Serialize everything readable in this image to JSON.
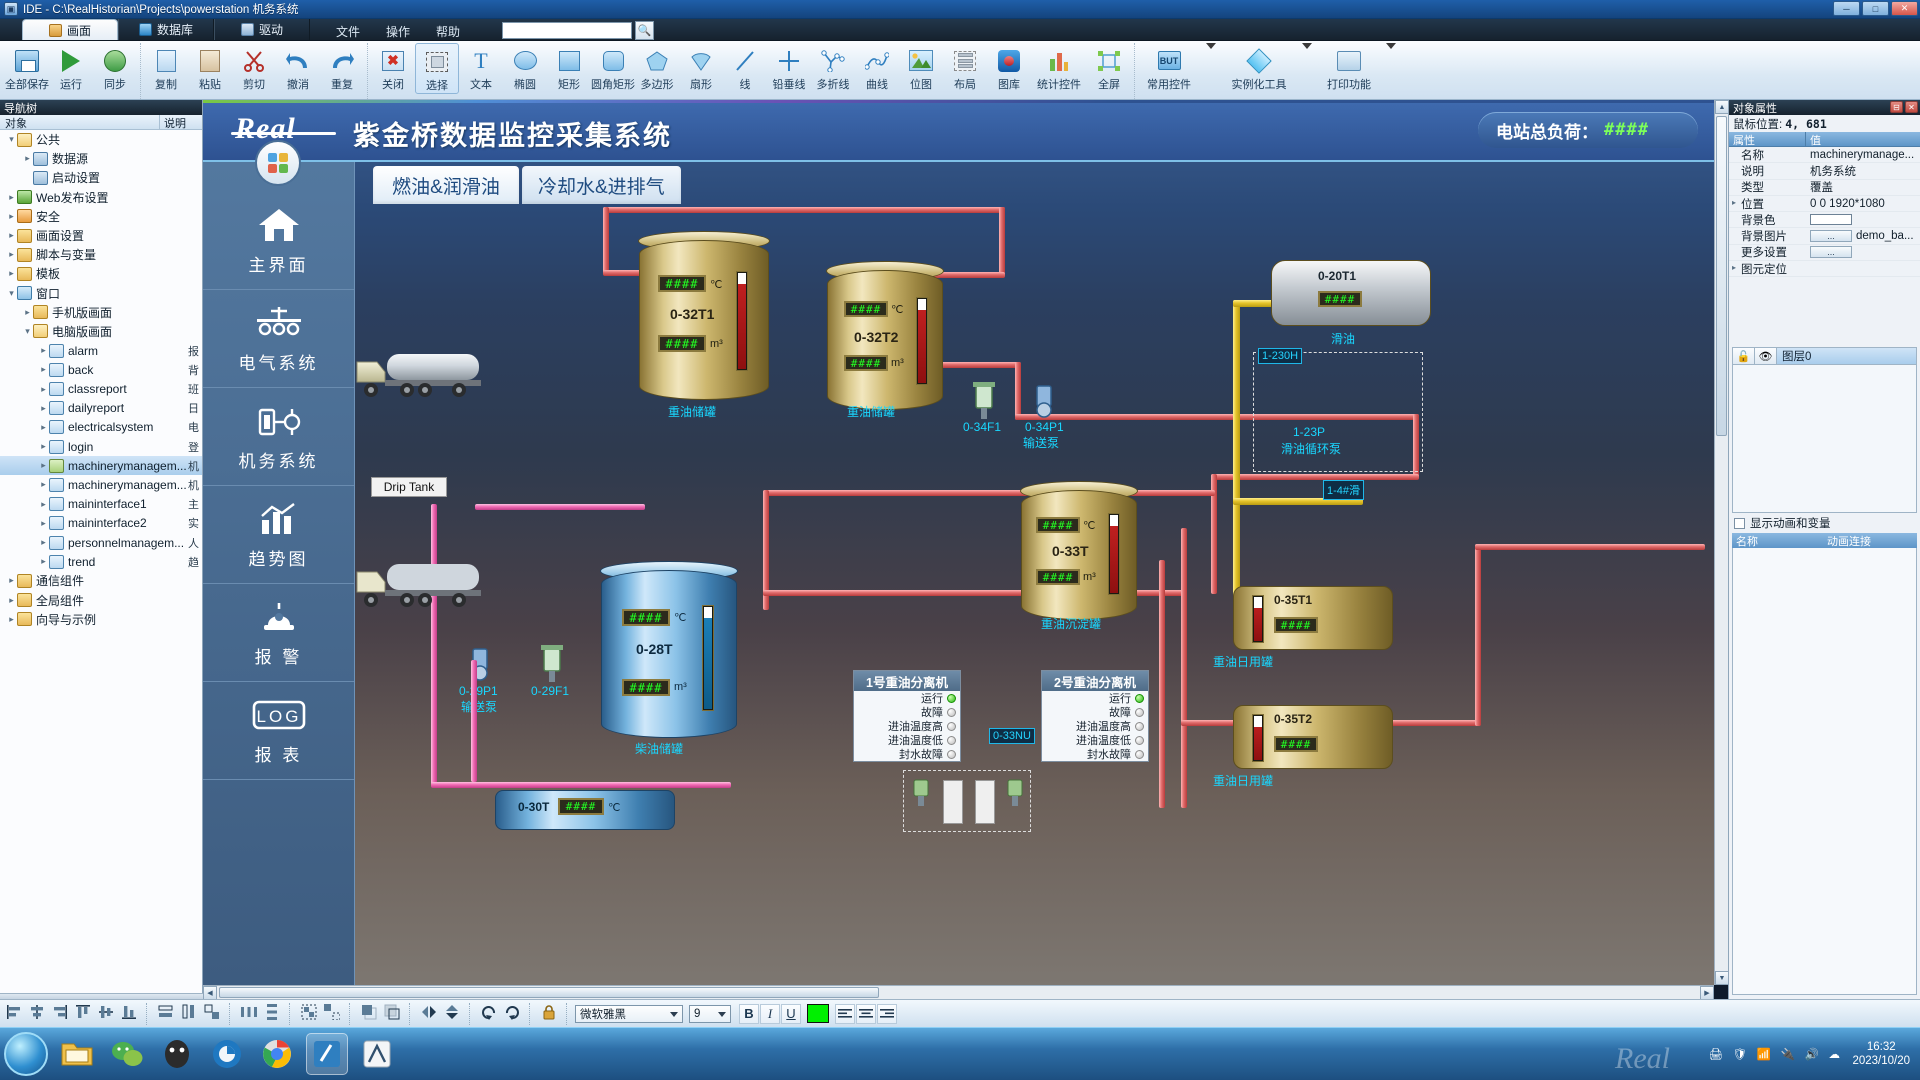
{
  "window": {
    "title": "IDE - C:\\RealHistorian\\Projects\\powerstation  机务系统",
    "minimize": "─",
    "maximize": "□",
    "close": "✕"
  },
  "ribbon_tabs": [
    {
      "label": "画面",
      "icon": "picture-icon",
      "active": true
    },
    {
      "label": "数据库",
      "icon": "database-icon",
      "active": false
    },
    {
      "label": "驱动",
      "icon": "driver-icon",
      "active": false
    }
  ],
  "menu": [
    "文件",
    "操作",
    "帮助"
  ],
  "search": {
    "value": "",
    "placeholder": "",
    "icon": "search-icon"
  },
  "toolbar_groups": [
    {
      "items": [
        {
          "label": "全部保存",
          "icon": "save-all-icon"
        },
        {
          "label": "运行",
          "icon": "run-icon"
        },
        {
          "label": "同步",
          "icon": "sync-icon"
        }
      ]
    },
    {
      "items": [
        {
          "label": "复制",
          "icon": "copy-icon"
        },
        {
          "label": "粘贴",
          "icon": "paste-icon"
        },
        {
          "label": "剪切",
          "icon": "cut-icon"
        },
        {
          "label": "撤消",
          "icon": "undo-icon"
        },
        {
          "label": "重复",
          "icon": "redo-icon"
        }
      ]
    },
    {
      "items": [
        {
          "label": "关闭",
          "icon": "close-window-icon"
        },
        {
          "label": "选择",
          "icon": "select-icon",
          "selected": true
        },
        {
          "label": "文本",
          "icon": "text-icon"
        },
        {
          "label": "椭圆",
          "icon": "ellipse-icon"
        },
        {
          "label": "矩形",
          "icon": "rectangle-icon"
        },
        {
          "label": "圆角矩形",
          "icon": "rounded-rectangle-icon"
        },
        {
          "label": "多边形",
          "icon": "polygon-icon"
        },
        {
          "label": "扇形",
          "icon": "sector-icon"
        },
        {
          "label": "线",
          "icon": "line-icon"
        },
        {
          "label": "铅垂线",
          "icon": "plumb-line-icon"
        },
        {
          "label": "多折线",
          "icon": "polyline-icon"
        },
        {
          "label": "曲线",
          "icon": "curve-icon"
        },
        {
          "label": "位图",
          "icon": "bitmap-icon"
        },
        {
          "label": "布局",
          "icon": "layout-icon"
        },
        {
          "label": "图库",
          "icon": "gallery-icon"
        },
        {
          "label": "统计控件",
          "icon": "chart-control-icon"
        },
        {
          "label": "全屏",
          "icon": "fullscreen-icon"
        }
      ]
    },
    {
      "items": [
        {
          "label": "常用控件",
          "icon": "common-control-icon",
          "dropdown": true
        },
        {
          "label": "实例化工具",
          "icon": "instantiate-tool-icon",
          "dropdown": true
        },
        {
          "label": "打印功能",
          "icon": "print-icon",
          "dropdown": true
        }
      ]
    }
  ],
  "nav": {
    "header": "导航树",
    "columns": [
      "对象",
      "说明"
    ],
    "tree": [
      {
        "depth": 0,
        "label": "公共",
        "icon": "folder-open-icon",
        "twist": "▾",
        "desc": ""
      },
      {
        "depth": 1,
        "label": "数据源",
        "icon": "datasource-icon",
        "twist": "▸",
        "desc": ""
      },
      {
        "depth": 1,
        "label": "启动设置",
        "icon": "startup-icon",
        "twist": "",
        "desc": ""
      },
      {
        "depth": 0,
        "label": "Web发布设置",
        "icon": "web-folder-icon",
        "twist": "▸",
        "desc": ""
      },
      {
        "depth": 0,
        "label": "安全",
        "icon": "security-folder-icon",
        "twist": "▸",
        "desc": ""
      },
      {
        "depth": 0,
        "label": "画面设置",
        "icon": "screen-settings-folder-icon",
        "twist": "▸",
        "desc": ""
      },
      {
        "depth": 0,
        "label": "脚本与变量",
        "icon": "script-folder-icon",
        "twist": "▸",
        "desc": ""
      },
      {
        "depth": 0,
        "label": "模板",
        "icon": "template-folder-icon",
        "twist": "▸",
        "desc": ""
      },
      {
        "depth": 0,
        "label": "窗口",
        "icon": "window-folder-icon",
        "twist": "▾",
        "desc": ""
      },
      {
        "depth": 1,
        "label": "手机版画面",
        "icon": "folder-closed-icon",
        "twist": "▸",
        "desc": ""
      },
      {
        "depth": 1,
        "label": "电脑版画面",
        "icon": "folder-open-icon",
        "twist": "▾",
        "desc": ""
      },
      {
        "depth": 2,
        "label": "alarm",
        "icon": "document-icon",
        "twist": "▸",
        "desc": "报"
      },
      {
        "depth": 2,
        "label": "back",
        "icon": "document-icon",
        "twist": "▸",
        "desc": "背"
      },
      {
        "depth": 2,
        "label": "classreport",
        "icon": "document-icon",
        "twist": "▸",
        "desc": "班"
      },
      {
        "depth": 2,
        "label": "dailyreport",
        "icon": "document-icon",
        "twist": "▸",
        "desc": "日"
      },
      {
        "depth": 2,
        "label": "electricalsystem",
        "icon": "document-icon",
        "twist": "▸",
        "desc": "电"
      },
      {
        "depth": 2,
        "label": "login",
        "icon": "document-icon",
        "twist": "▸",
        "desc": "登"
      },
      {
        "depth": 2,
        "label": "machinerymanagem...",
        "icon": "document-selected-icon",
        "twist": "▸",
        "desc": "机",
        "selected": true
      },
      {
        "depth": 2,
        "label": "machinerymanagem...",
        "icon": "document-icon",
        "twist": "▸",
        "desc": "机"
      },
      {
        "depth": 2,
        "label": "maininterface1",
        "icon": "document-icon",
        "twist": "▸",
        "desc": "主"
      },
      {
        "depth": 2,
        "label": "maininterface2",
        "icon": "document-icon",
        "twist": "▸",
        "desc": "实"
      },
      {
        "depth": 2,
        "label": "personnelmanagem...",
        "icon": "document-icon",
        "twist": "▸",
        "desc": "人"
      },
      {
        "depth": 2,
        "label": "trend",
        "icon": "document-icon",
        "twist": "▸",
        "desc": "趋"
      },
      {
        "depth": 0,
        "label": "通信组件",
        "icon": "folder-closed-icon",
        "twist": "▸",
        "desc": ""
      },
      {
        "depth": 0,
        "label": "全局组件",
        "icon": "folder-closed-icon",
        "twist": "▸",
        "desc": ""
      },
      {
        "depth": 0,
        "label": "向导与示例",
        "icon": "folder-closed-icon",
        "twist": "▸",
        "desc": ""
      }
    ]
  },
  "scada": {
    "logo_text": "Real",
    "title": "紫金桥数据监控采集系统",
    "total_load": {
      "label": "电站总负荷：",
      "value": "####"
    },
    "side_nav": [
      {
        "label": "主界面",
        "icon": "home-icon"
      },
      {
        "label": "电气系统",
        "icon": "electrical-icon"
      },
      {
        "label": "机务系统",
        "icon": "machinery-icon"
      },
      {
        "label": "趋势图",
        "icon": "trend-chart-icon"
      },
      {
        "label": "报 警",
        "icon": "alarm-icon"
      },
      {
        "label": "报 表",
        "icon": "report-log-icon"
      }
    ],
    "tabs": [
      {
        "label": "燃油&润滑油",
        "active": true
      },
      {
        "label": "冷却水&进排气",
        "active": false
      }
    ],
    "tanks": [
      {
        "id": "0-32T1",
        "temp": "####",
        "temp_unit": "℃",
        "vol": "####",
        "vol_unit": "m³",
        "caption": "重油储罐",
        "color": "gold"
      },
      {
        "id": "0-32T2",
        "temp": "####",
        "temp_unit": "℃",
        "vol": "####",
        "vol_unit": "m³",
        "caption": "重油储罐",
        "color": "gold"
      },
      {
        "id": "0-33T",
        "temp": "####",
        "temp_unit": "℃",
        "vol": "####",
        "vol_unit": "m³",
        "caption": "重油沉淀罐",
        "color": "gold"
      },
      {
        "id": "0-28T",
        "temp": "####",
        "temp_unit": "℃",
        "vol": "####",
        "vol_unit": "m³",
        "caption": "柴油储罐",
        "color": "blue"
      }
    ],
    "side_tanks": [
      {
        "id": "0-35T1",
        "temp": "####",
        "vol": "####",
        "caption": "重油日用罐"
      },
      {
        "id": "0-35T2",
        "temp": "####",
        "vol": "####",
        "caption": "重油日用罐"
      }
    ],
    "pumps": [
      {
        "tag": "0-34F1",
        "label": ""
      },
      {
        "tag": "0-34P1",
        "label": "输送泵"
      },
      {
        "tag": "0-29P1",
        "label": "输送泵"
      },
      {
        "tag": "0-29F1",
        "label": ""
      },
      {
        "tag": "1-23P",
        "label": "滑油循环泵"
      }
    ],
    "misc_labels": [
      {
        "text": "Drip Tank"
      },
      {
        "text": "0-20T1"
      },
      {
        "text": "1-230H"
      },
      {
        "text": "1-4#滑"
      },
      {
        "text": "滑油"
      },
      {
        "text": "0-33NU"
      },
      {
        "text": "0-30T"
      },
      {
        "text": "####"
      }
    ],
    "separators": [
      {
        "title": "1号重油分离机",
        "rows": [
          {
            "label": "运行",
            "on": true
          },
          {
            "label": "故障",
            "on": false
          },
          {
            "label": "进油温度高",
            "on": false
          },
          {
            "label": "进油温度低",
            "on": false
          },
          {
            "label": "封水故障",
            "on": false
          }
        ]
      },
      {
        "title": "2号重油分离机",
        "rows": [
          {
            "label": "运行",
            "on": true
          },
          {
            "label": "故障",
            "on": false
          },
          {
            "label": "进油温度高",
            "on": false
          },
          {
            "label": "进油温度低",
            "on": false
          },
          {
            "label": "封水故障",
            "on": false
          }
        ]
      }
    ]
  },
  "properties": {
    "panel_title": "对象属性",
    "mouse_label": "鼠标位置:",
    "mouse_value": "4, 681",
    "columns": [
      "属性",
      "值"
    ],
    "rows": [
      {
        "key": "名称",
        "value": "machinerymanage...",
        "type": "text",
        "twist": ""
      },
      {
        "key": "说明",
        "value": "机务系统",
        "type": "text",
        "twist": ""
      },
      {
        "key": "类型",
        "value": "覆盖",
        "type": "text",
        "twist": ""
      },
      {
        "key": "位置",
        "value": "0 0 1920*1080",
        "type": "text",
        "twist": "▸"
      },
      {
        "key": "背景色",
        "value": "",
        "type": "color",
        "color": "#ffffff",
        "twist": ""
      },
      {
        "key": "背景图片",
        "value": "demo_ba...",
        "type": "button",
        "button": "...",
        "twist": ""
      },
      {
        "key": "更多设置",
        "value": "",
        "type": "button",
        "button": "...",
        "twist": ""
      },
      {
        "key": "图元定位",
        "value": "",
        "type": "text",
        "twist": "▸"
      }
    ]
  },
  "layers": {
    "lock_icon": "unlock-icon",
    "eye_icon": "eye-icon",
    "name": "图层0"
  },
  "animation": {
    "checkbox_label": "显示动画和变量",
    "checked": false,
    "columns": [
      "名称",
      "动画连接"
    ]
  },
  "bottom_toolbar": {
    "align_tools": [
      "align-left",
      "align-center-h",
      "align-right",
      "align-top",
      "align-middle-v",
      "align-bottom",
      "same-width",
      "same-height",
      "same-size",
      "space-h",
      "space-v",
      "group",
      "ungroup",
      "bring-front",
      "send-back",
      "flip-h",
      "flip-v",
      "rotate-left",
      "rotate-right",
      "lock"
    ],
    "font_family": "微软雅黑",
    "font_size": "9",
    "bold": "B",
    "italic": "I",
    "underline": "U",
    "text_color": "#00f000",
    "text_align": [
      "left",
      "center",
      "right"
    ]
  },
  "taskbar": {
    "apps": [
      "start-orb",
      "explorer-icon",
      "wechat-icon",
      "qq-icon",
      "firefox-icon",
      "chrome-icon",
      "ide-icon",
      "app-icon"
    ],
    "tray": [
      "printer-icon",
      "shield-icon",
      "network-icon",
      "usb-icon",
      "sound-icon",
      "cloud-icon"
    ],
    "time": "16:32",
    "date": "2023/10/20"
  }
}
